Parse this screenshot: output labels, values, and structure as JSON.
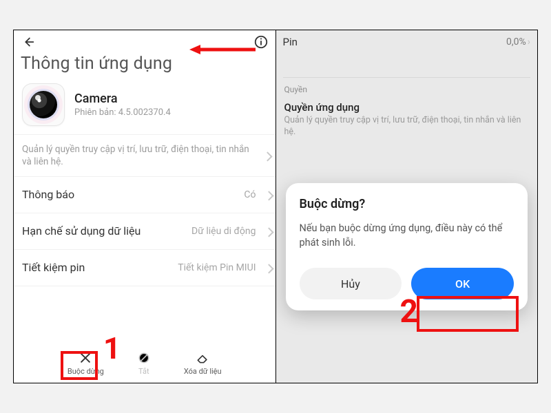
{
  "left": {
    "page_title": "Thông tin ứng dụng",
    "app": {
      "name": "Camera",
      "version_label": "Phiên bản: 4.5.002370.4"
    },
    "permissions_summary": "Quản lý quyền truy cập vị trí, lưu trữ, điện thoại, tin nhắn và liên hệ.",
    "rows": {
      "notifications": {
        "label": "Thông báo",
        "value": "Có"
      },
      "data_limit": {
        "label": "Hạn chế sử dụng dữ liệu",
        "value": "Dữ liệu di động"
      },
      "battery": {
        "label": "Tiết kiệm pin",
        "value": "Tiết kiệm Pin MIUI"
      }
    },
    "actions": {
      "force_stop": "Buộc dừng",
      "disable": "Tắt",
      "clear_data": "Xóa dữ liệu"
    },
    "annotation_number": "1"
  },
  "right": {
    "battery_label": "Pin",
    "battery_value": "0,0%",
    "perm_caption": "Quyền",
    "perm_title": "Quyền ứng dụng",
    "perm_desc": "Quản lý quyền truy cập vị trí, lưu trữ, điện thoại, tin nhắn và liên hệ.",
    "modal": {
      "title": "Buộc dừng?",
      "message": "Nếu bạn buộc dừng ứng dụng, điều này có thể phát sinh lỗi.",
      "cancel": "Hủy",
      "ok": "OK"
    },
    "annotation_number": "2"
  }
}
